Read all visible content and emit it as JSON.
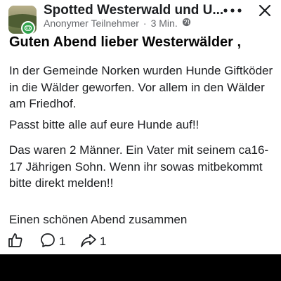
{
  "group": {
    "name": "Spotted Westerwald und U...",
    "author": "Anonymer Teilnehmer",
    "separator": "·",
    "time": "3 Min."
  },
  "icons": {
    "more": "more-icon",
    "close": "close-icon",
    "audience": "public-globe-icon",
    "badge": "anonymous-badge-icon",
    "like": "like-icon",
    "comment": "comment-icon",
    "share": "share-icon"
  },
  "post": {
    "title": "Guten Abend lieber Westerwälder ,",
    "paragraphs": [
      "In der Gemeinde Norken wurden Hunde Giftköder in die Wälder geworfen. Vor allem in den Wälder am Friedhof.",
      "Passt bitte alle auf eure Hunde auf!!",
      "Das waren 2 Männer. Ein Vater mit seinem ca16-17 Jährigen Sohn. Wenn ihr sowas mitbekommt bitte direkt melden!!",
      "Einen schönen Abend zusammen"
    ]
  },
  "actions": {
    "comment_count": "1",
    "share_count": "1"
  },
  "colors": {
    "text": "#1c1e21",
    "meta": "#65676b",
    "badge": "#31a24c",
    "bottom_bar": "#000000"
  }
}
